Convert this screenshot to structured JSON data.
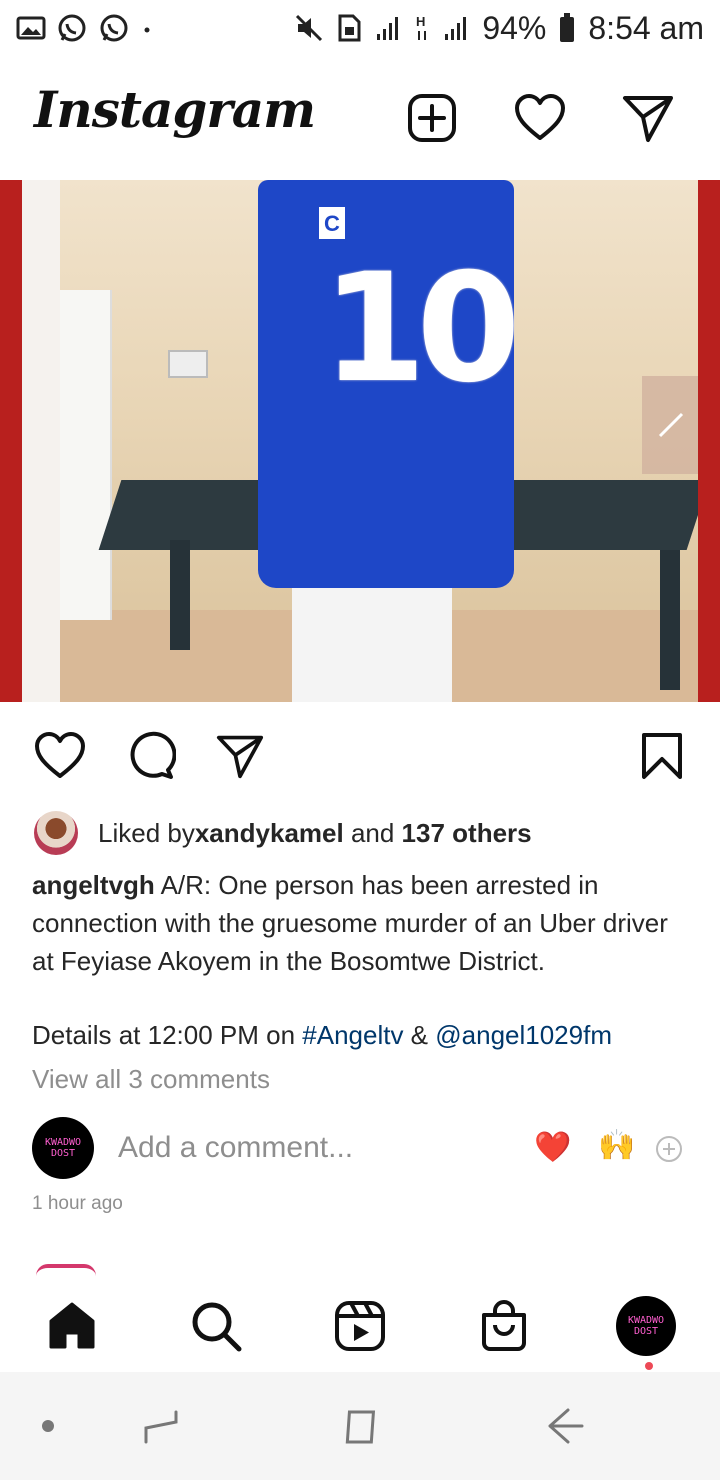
{
  "status_bar": {
    "battery": "94%",
    "time": "8:54 am",
    "left_icons": [
      "gallery-icon",
      "whatsapp-icon",
      "whatsapp-icon",
      "dot-icon"
    ],
    "right_icons": [
      "mute-icon",
      "sim-icon",
      "signal-icon",
      "h-network-icon",
      "signal-icon",
      "battery-icon"
    ]
  },
  "header": {
    "logo": "Instagram",
    "icons": [
      "new-post-icon",
      "heart-icon",
      "direct-message-icon"
    ]
  },
  "post": {
    "jersey_number": "10",
    "jersey_patch": "C",
    "actions": [
      "like-icon",
      "comment-icon",
      "share-icon",
      "bookmark-icon"
    ],
    "likes_prefix": "Liked by ",
    "liked_by_user": "xandykamel",
    "likes_middle": " and ",
    "likes_others": "137 others",
    "username": "angeltvgh",
    "caption": " A/R: One person has been arrested in connection with the gruesome murder of an Uber driver at Feyiase Akoyem in the Bosomtwe District.",
    "details_prefix": "Details at 12:00 PM on ",
    "hashtag": "#Angeltv",
    "details_amp": " & ",
    "mention": "@angel1029fm",
    "view_comments": "View all 3 comments",
    "comment_placeholder": "Add a comment...",
    "avatar_text_line1": "KWADWO",
    "avatar_text_line2": "DOST",
    "quick_emojis": [
      "❤️",
      "🙌"
    ],
    "time_ago": "1 hour ago"
  },
  "bottom_nav": [
    "home-icon",
    "search-icon",
    "reels-icon",
    "shop-icon",
    "profile-avatar"
  ],
  "system_nav": [
    "dot-button",
    "recents-button",
    "home-button",
    "back-button"
  ],
  "colors": {
    "link": "#00376b",
    "muted": "#8e8e8e",
    "notification": "#ed4956",
    "heart": "#e0245e"
  }
}
